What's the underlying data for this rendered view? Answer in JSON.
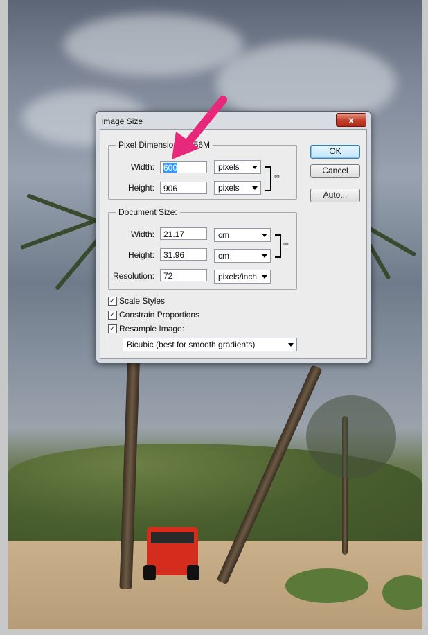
{
  "dialog": {
    "title": "Image Size",
    "close_label": "x",
    "buttons": {
      "ok": "OK",
      "cancel": "Cancel",
      "auto": "Auto..."
    },
    "pixel_dimensions": {
      "legend": "Pixel Dimensions: 1.56M",
      "width_label": "Width:",
      "width_value": "600",
      "width_unit": "pixels",
      "height_label": "Height:",
      "height_value": "906",
      "height_unit": "pixels"
    },
    "document_size": {
      "legend": "Document Size:",
      "width_label": "Width:",
      "width_value": "21.17",
      "width_unit": "cm",
      "height_label": "Height:",
      "height_value": "31.96",
      "height_unit": "cm",
      "resolution_label": "Resolution:",
      "resolution_value": "72",
      "resolution_unit": "pixels/inch"
    },
    "options": {
      "scale_styles": "Scale Styles",
      "constrain_proportions": "Constrain Proportions",
      "resample_image": "Resample Image:",
      "resample_method": "Bicubic (best for smooth gradients)"
    },
    "icons": {
      "link": "chain-link-icon",
      "check": "checkmark-icon",
      "dropdown": "chevron-down-icon"
    }
  },
  "colors": {
    "annotation_arrow": "#e8287a",
    "ok_button_border": "#3c7fb1"
  }
}
